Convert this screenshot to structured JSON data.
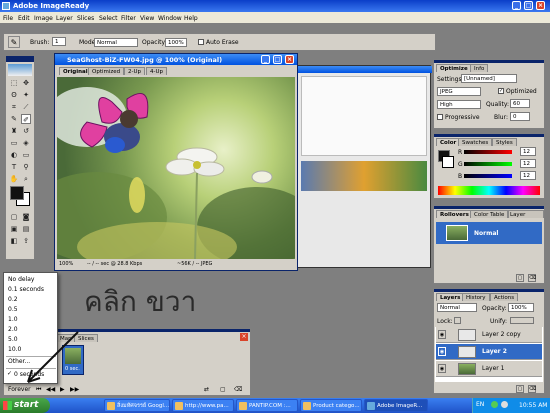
{
  "app": {
    "title": "Adobe ImageReady"
  },
  "menu": [
    "File",
    "Edit",
    "Image",
    "Layer",
    "Slices",
    "Select",
    "Filter",
    "View",
    "Window",
    "Help"
  ],
  "options_bar": {
    "brush_label": "Brush:",
    "brush_size": "1",
    "mode_label": "Mode:",
    "mode_value": "Normal",
    "opacity_label": "Opacity:",
    "opacity_value": "100%",
    "auto_erase_label": "Auto Erase"
  },
  "document": {
    "title": "SeaGhost-BiZ-FW04.jpg @ 100% (Original)",
    "tabs": [
      "Original",
      "Optimized",
      "2-Up",
      "4-Up"
    ],
    "zoom": "100%",
    "status1": "-- / -- sec @ 28.8 Kbps",
    "status2": "~56K / -- JPEG"
  },
  "optimize": {
    "tabs": [
      "Optimize",
      "Info"
    ],
    "settings_label": "Settings:",
    "settings_value": "[Unnamed]",
    "format": "JPEG",
    "optimized_label": "Optimized",
    "quality_level": "High",
    "quality_label": "Quality:",
    "quality_value": "60",
    "progressive_label": "Progressive",
    "blur_label": "Blur:",
    "blur_value": "0"
  },
  "color": {
    "tabs": [
      "Color",
      "Swatches",
      "Styles"
    ],
    "r_label": "R",
    "r_value": "12",
    "g_label": "G",
    "g_value": "12",
    "b_label": "B",
    "b_value": "12"
  },
  "rollovers": {
    "tabs": [
      "Rollovers",
      "Color Table",
      "Layer Options"
    ],
    "state": "Normal"
  },
  "layers": {
    "tabs": [
      "Layers",
      "History",
      "Actions"
    ],
    "blend": "Normal",
    "opacity_label": "Opacity:",
    "opacity_value": "100%",
    "lock_label": "Lock:",
    "unify_label": "Unify:",
    "items": [
      {
        "name": "Layer 2 copy"
      },
      {
        "name": "Layer 2"
      },
      {
        "name": "Layer 1"
      }
    ]
  },
  "animation": {
    "tabs": [
      "Map",
      "Slices"
    ],
    "frame_delay": "0 sec.",
    "loop_value": "Forever"
  },
  "delay_menu": {
    "items": [
      "No delay",
      "0.1 seconds",
      "0.2",
      "0.5",
      "1.0",
      "2.0",
      "5.0",
      "10.0",
      "Other...",
      "0 seconds"
    ],
    "current": "0 seconds"
  },
  "annotation": {
    "text": "คลิก ขวา"
  },
  "taskbar": {
    "start": "start",
    "items": [
      "สิ่งมหัศจรรย์ Googl...",
      "http://www.pa...",
      "PANTIP.COM :...",
      "Product catego...",
      "Adobe ImageR..."
    ],
    "lang": "EN",
    "clock": "10:55 AM"
  },
  "colors": {
    "accent": "#0a246a",
    "xp_blue": "#245edb",
    "panel": "#d4d0c8",
    "desktop": "#7f7f7f"
  }
}
